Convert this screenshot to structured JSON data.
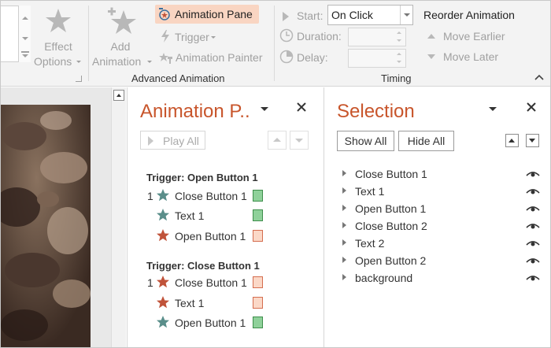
{
  "ribbon": {
    "effect_options_line1": "Effect",
    "effect_options_line2": "Options",
    "add_animation_line1": "Add",
    "add_animation_line2": "Animation",
    "animation_pane": "Animation Pane",
    "trigger": "Trigger",
    "animation_painter": "Animation Painter",
    "group_advanced": "Advanced Animation",
    "start_label": "Start:",
    "start_value": "On Click",
    "duration_label": "Duration:",
    "delay_label": "Delay:",
    "group_timing": "Timing",
    "reorder_title": "Reorder Animation",
    "move_earlier": "Move Earlier",
    "move_later": "Move Later"
  },
  "animation_pane": {
    "title": "Animation P..",
    "play_all": "Play All",
    "groups": [
      {
        "trigger": "Trigger: Open Button 1",
        "items": [
          {
            "num": "1",
            "label": "Close Button 1",
            "star": "#5a8e8a",
            "box": "green"
          },
          {
            "num": "",
            "label": "Text 1",
            "star": "#5a8e8a",
            "box": "green"
          },
          {
            "num": "",
            "label": "Open Button 1",
            "star": "#c0533a",
            "box": "orange"
          }
        ]
      },
      {
        "trigger": "Trigger: Close Button 1",
        "items": [
          {
            "num": "1",
            "label": "Close Button 1",
            "star": "#c0533a",
            "box": "orange"
          },
          {
            "num": "",
            "label": "Text 1",
            "star": "#c0533a",
            "box": "orange"
          },
          {
            "num": "",
            "label": "Open Button 1",
            "star": "#5a8e8a",
            "box": "green"
          }
        ]
      }
    ]
  },
  "selection_pane": {
    "title": "Selection",
    "show_all": "Show All",
    "hide_all": "Hide All",
    "items": [
      "Close Button 1",
      "Text 1",
      "Open Button 1",
      "Close Button 2",
      "Text 2",
      "Open Button 2",
      "background"
    ]
  },
  "colors": {
    "accent_orange": "#c8552b",
    "check_green": "#8fd19a",
    "check_orange": "#fbd8c7"
  }
}
